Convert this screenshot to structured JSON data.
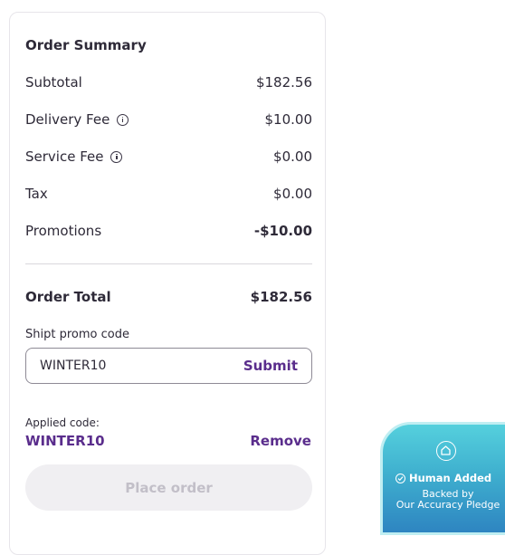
{
  "summary": {
    "title": "Order Summary",
    "rows": [
      {
        "label": "Subtotal",
        "value": "$182.56"
      },
      {
        "label": "Delivery Fee",
        "value": "$10.00"
      },
      {
        "label": "Service Fee",
        "value": "$0.00"
      },
      {
        "label": "Tax",
        "value": "$0.00"
      },
      {
        "label": "Promotions",
        "value": "-$10.00"
      }
    ],
    "total_label": "Order Total",
    "total_value": "$182.56"
  },
  "promo": {
    "label": "Shipt promo code",
    "input_value": "WINTER10",
    "submit_label": "Submit",
    "applied_label": "Applied code:",
    "applied_code": "WINTER10",
    "remove_label": "Remove"
  },
  "place_order_label": "Place order",
  "badge": {
    "title": "Human Added",
    "line1": "Backed by",
    "line2": "Our Accuracy Pledge"
  },
  "colors": {
    "accent": "#5a2d8c",
    "negative": "#b1391b"
  }
}
